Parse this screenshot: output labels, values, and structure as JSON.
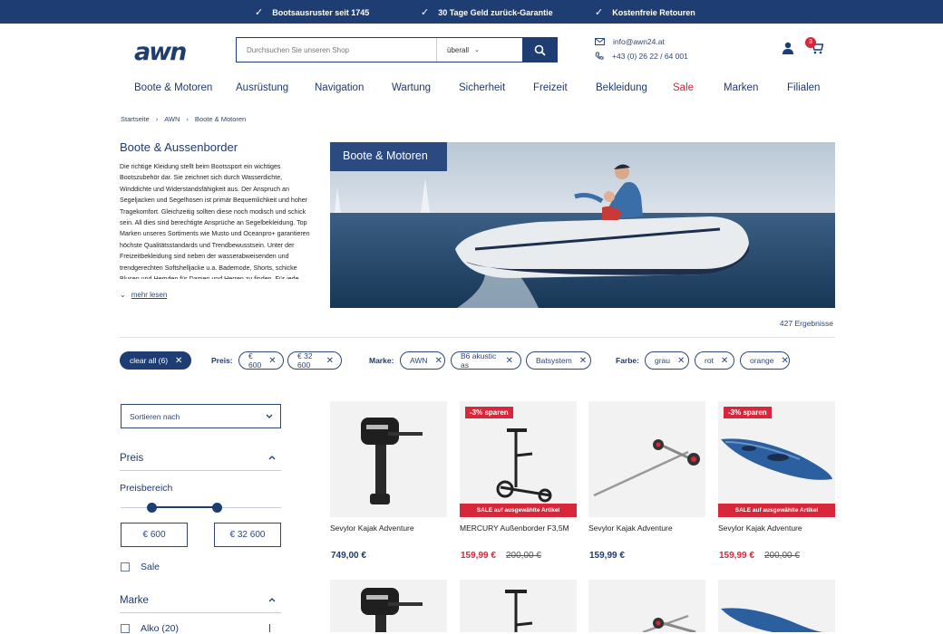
{
  "topbar": {
    "usps": [
      "Bootsausruster seit 1745",
      "30 Tage Geld zurück-Garantie",
      "Kostenfreie Retouren"
    ]
  },
  "header": {
    "logo_text": "awn",
    "search_placeholder": "Durchsuchen Sie unseren Shop",
    "search_scope": "überall",
    "email": "info@awn24.at",
    "phone": "+43 (0) 26 22 / 64 001",
    "cart_count": "3"
  },
  "nav": {
    "items": [
      "Boote & Motoren",
      "Ausrüstung",
      "Navigation",
      "Wartung",
      "Sicherheit",
      "Freizeit",
      "Bekleidung",
      "Sale",
      "Marken",
      "Filialen"
    ]
  },
  "breadcrumb": [
    "Startseite",
    "AWN",
    "Boote & Motoren"
  ],
  "breadcrumb_sep": "›",
  "intro": {
    "title": "Boote & Aussenborder",
    "text": "Die richtige Kleidung stellt beim Bootssport ein wichtiges Bootszubehör dar. Sie zeichnet sich durch Wasserdichte, Winddichte und Widerstandsfähigkeit aus. Der Anspruch an Segeljacken und Segelhosen ist primär Bequemlichkeit und hoher Tragekomfort. Gleichzeitig sollten diese noch modisch und schick sein. All dies sind berechtigte Ansprüche an Segelbekleidung. Top Marken unseres Sortiments wie Musto und Oceanpro+ garantieren höchste Qualitätsstandards und Trendbewusstsein. Unter der Freizeitbekleidung sind neben der wasserabweisenden und trendgerechten Softshelljacke u.a. Bademode, Shorts, schicke Blusen und Hemden für Damen und Herren zu finden. Für jede",
    "more_label": "mehr lesen"
  },
  "hero": {
    "label": "Boote & Motoren"
  },
  "results": "427 Ergebnisse",
  "filters": {
    "clear_all": "clear all (6)",
    "price_label": "Preis:",
    "price_chips": [
      "€ 600",
      "€ 32 600"
    ],
    "brand_label": "Marke:",
    "brand_chips": [
      "AWN",
      "B6 akustic as",
      "Batsystem"
    ],
    "color_label": "Farbe:",
    "color_chips": [
      "grau",
      "rot",
      "orange"
    ]
  },
  "sidebar": {
    "sort_label": "Sortieren nach",
    "price_heading": "Preis",
    "range_label": "Preisbereich",
    "range_min": "€ 600",
    "range_max": "€ 32 600",
    "sale_label": "Sale",
    "brand_heading": "Marke",
    "brand_first": "Alko (20)"
  },
  "products": [
    {
      "name": "Sevylor Kajak Adventure",
      "price": "749,00 €",
      "old_price": "",
      "tag": "",
      "band": ""
    },
    {
      "name": "MERCURY Außenborder F3,5M",
      "price": "159,99 €",
      "old_price": "200,00 €",
      "tag": "-3% sparen",
      "band": "SALE auf ausgewählte Artikel"
    },
    {
      "name": "Sevylor Kajak Adventure",
      "price": "159,99 €",
      "old_price": "",
      "tag": "",
      "band": ""
    },
    {
      "name": "Sevylor Kajak Adventure",
      "price": "159,99 €",
      "old_price": "200,00 €",
      "tag": "-3% sparen",
      "band": "SALE auf ausgewählte Artikel"
    }
  ],
  "colors": {
    "primary": "#1e3d73",
    "sale": "#d8263a"
  }
}
